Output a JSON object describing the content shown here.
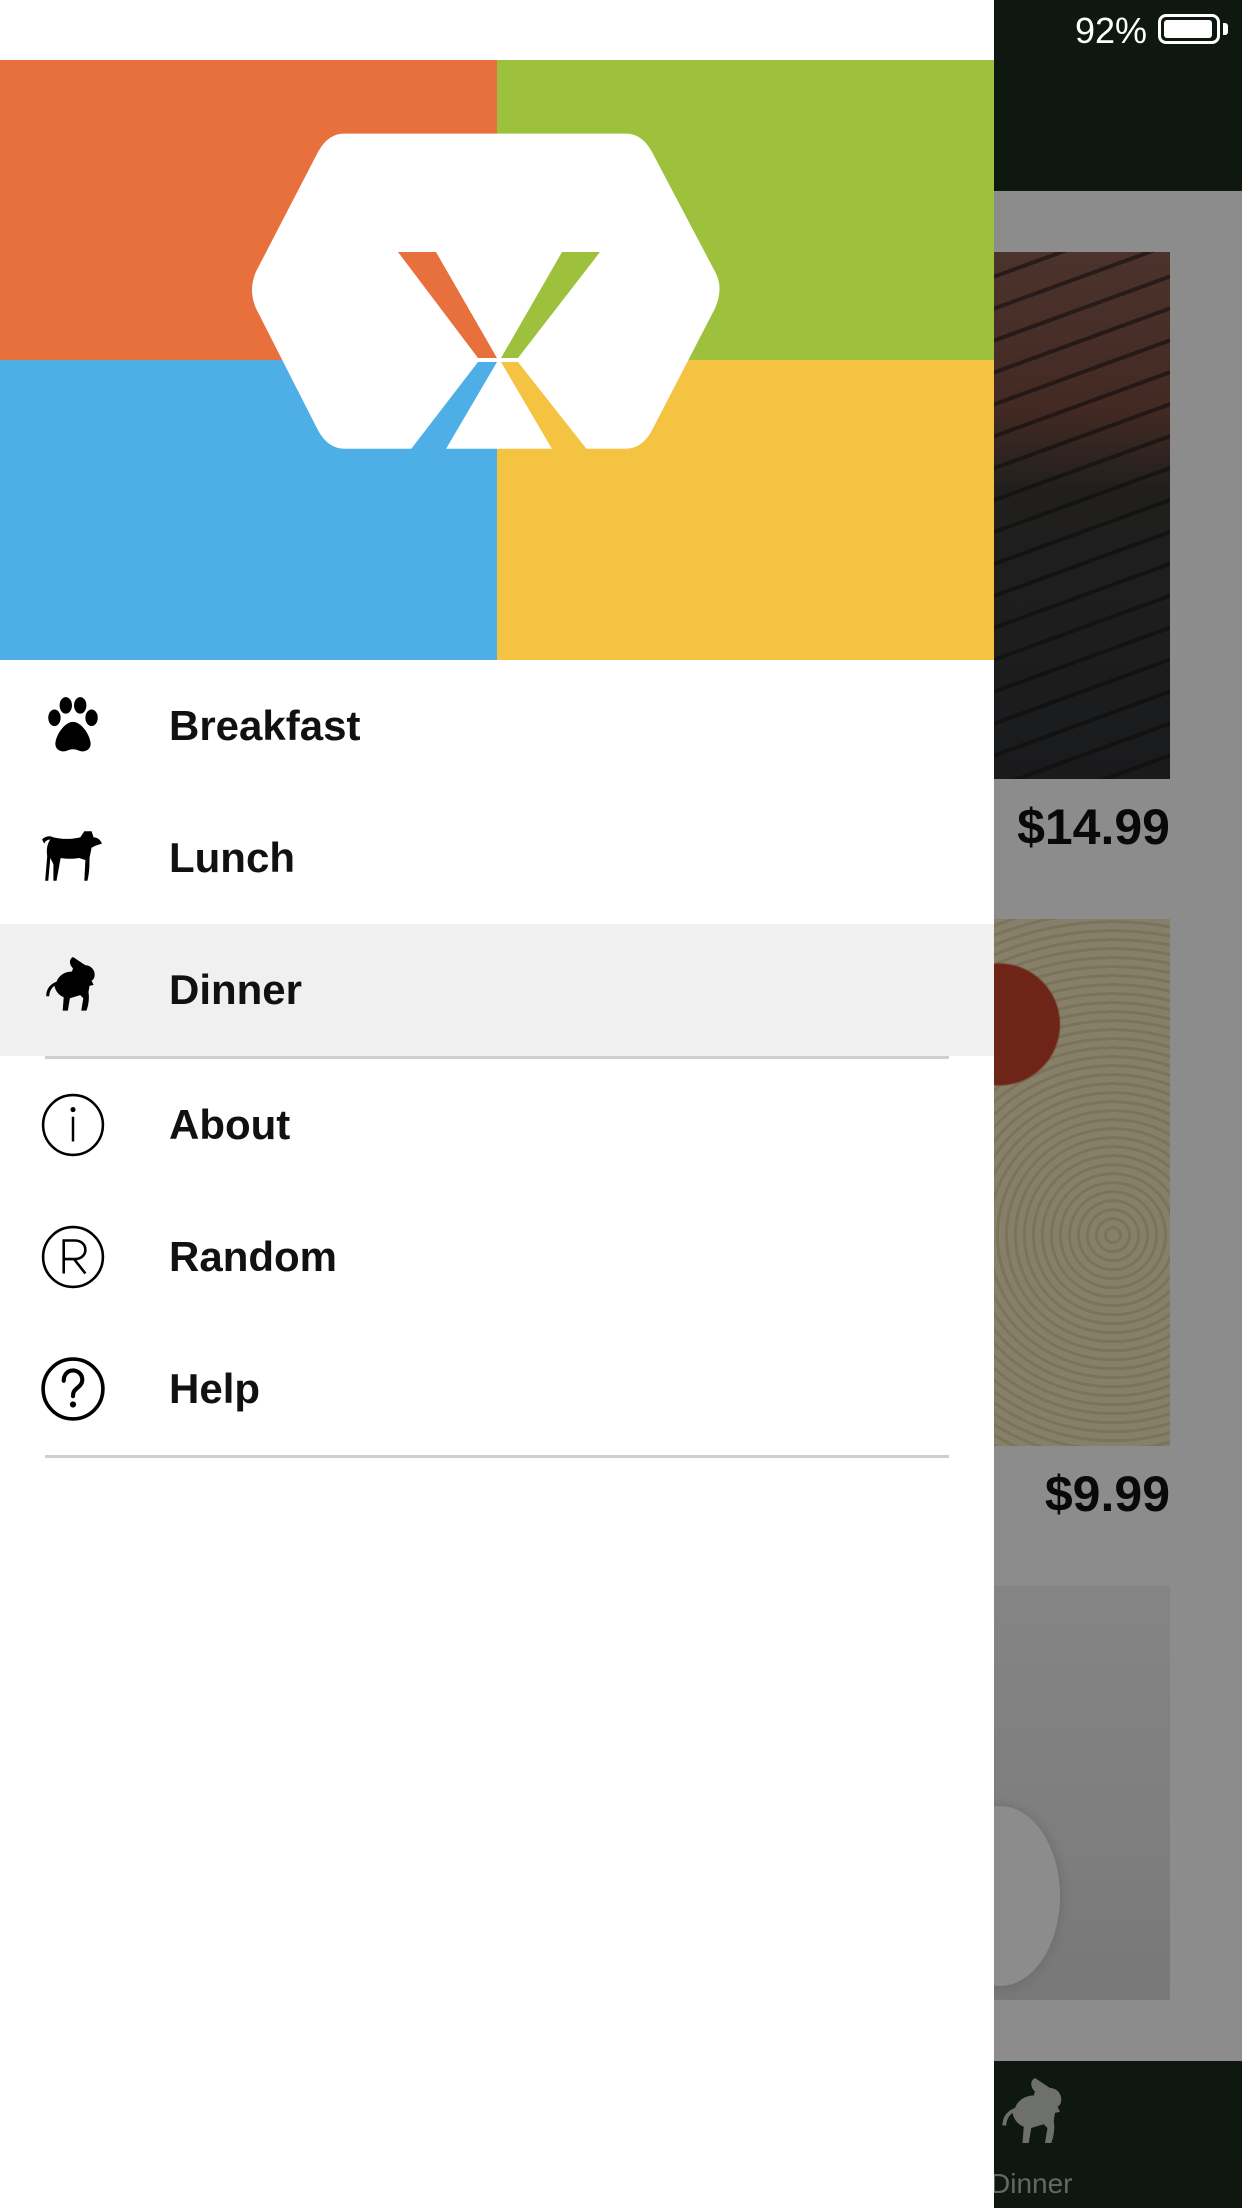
{
  "status_bar": {
    "battery_percent": "92%"
  },
  "background": {
    "prices": [
      "$14.99",
      "$9.99"
    ],
    "tab_bar": {
      "visible_tab_label": "Dinner",
      "icon": "baboon-icon"
    }
  },
  "drawer": {
    "header": {
      "logo": "xamarin-hexagon-logo",
      "colors": {
        "orange": "#E7703D",
        "green": "#9DC13C",
        "blue": "#4EAEE6",
        "yellow": "#F4C341"
      }
    },
    "items": [
      {
        "label": "Breakfast",
        "icon": "paw-icon"
      },
      {
        "label": "Lunch",
        "icon": "dog-icon"
      },
      {
        "label": "Dinner",
        "icon": "baboon-icon",
        "selected": true
      },
      {
        "label": "About",
        "icon": "info-circle-icon"
      },
      {
        "label": "Random",
        "icon": "registered-circle-icon"
      },
      {
        "label": "Help",
        "icon": "help-circle-icon"
      }
    ]
  }
}
